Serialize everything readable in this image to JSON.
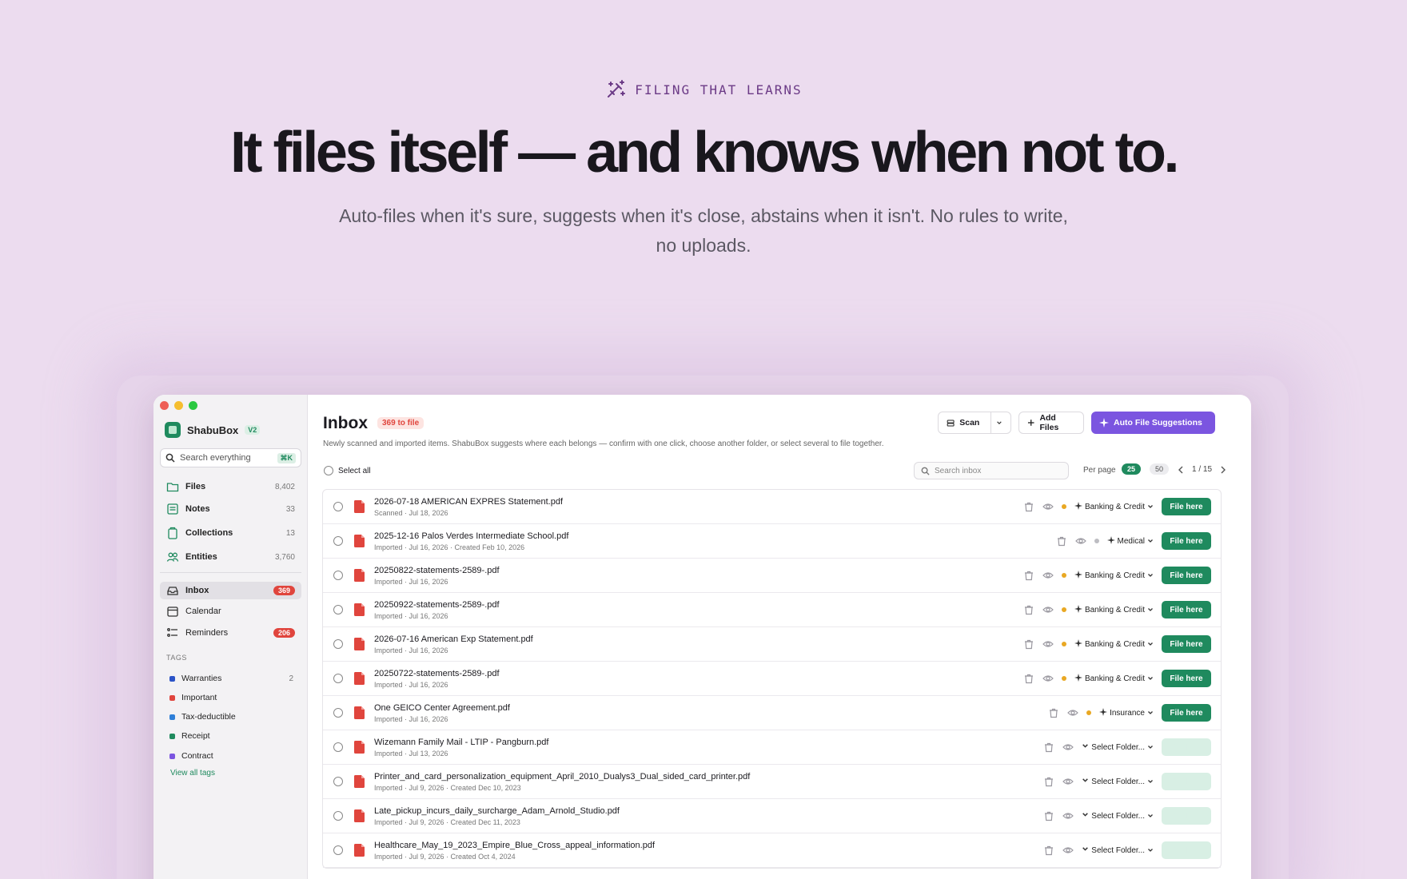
{
  "hero": {
    "eyebrow": "FILING THAT LEARNS",
    "headline": "It files itself — and knows when not to.",
    "subline": "Auto-files when it's sure, suggests when it's close, abstains when it isn't. No rules to write, no uploads."
  },
  "sidebar": {
    "app_name": "ShabuBox",
    "version": "V2",
    "search_placeholder": "Search everything",
    "search_shortcut": "⌘K",
    "library": [
      {
        "label": "Files",
        "count": "8,402",
        "icon": "folder-icon"
      },
      {
        "label": "Notes",
        "count": "33",
        "icon": "note-icon"
      },
      {
        "label": "Collections",
        "count": "13",
        "icon": "collection-icon"
      },
      {
        "label": "Entities",
        "count": "3,760",
        "icon": "people-icon"
      }
    ],
    "workspace": [
      {
        "label": "Inbox",
        "badge": "369",
        "icon": "inbox-icon",
        "active": true
      },
      {
        "label": "Calendar",
        "badge": "",
        "icon": "calendar-icon",
        "active": false
      },
      {
        "label": "Reminders",
        "badge": "206",
        "icon": "reminders-icon",
        "active": false
      }
    ],
    "tags_header": "TAGS",
    "tags": [
      {
        "label": "Warranties",
        "count": "2",
        "color": "#2b53c7"
      },
      {
        "label": "Important",
        "count": "",
        "color": "#e0453d"
      },
      {
        "label": "Tax-deductible",
        "count": "",
        "color": "#2f7fd8"
      },
      {
        "label": "Receipt",
        "count": "",
        "color": "#1f8a5e"
      },
      {
        "label": "Contract",
        "count": "",
        "color": "#7b55e0"
      }
    ],
    "view_all_tags": "View all tags"
  },
  "inbox": {
    "title": "Inbox",
    "badge": "369 to file",
    "description": "Newly scanned and imported items. ShabuBox suggests where each belongs — confirm with one click, choose another folder, or select several to file together.",
    "scan_label": "Scan",
    "add_files_label": "Add Files",
    "auto_suggest_label": "Auto File Suggestions",
    "select_all_label": "Select all",
    "search_placeholder": "Search inbox",
    "per_page_label": "Per page",
    "per_page_options": [
      "25",
      "50"
    ],
    "page_indicator": "1 / 15",
    "file_here_label": "File here",
    "rows": [
      {
        "name": "2026-07-18 AMERICAN EXPRES Statement.pdf",
        "meta": "Scanned · Jul 18, 2026",
        "folder": "Banking & Credit",
        "confidence": "#e9a823",
        "suggested": true
      },
      {
        "name": "2025-12-16 Palos Verdes Intermediate School.pdf",
        "meta": "Imported · Jul 16, 2026 · Created Feb 10, 2026",
        "folder": "Medical",
        "confidence": "#bdbdc2",
        "suggested": true
      },
      {
        "name": "20250822-statements-2589-.pdf",
        "meta": "Imported · Jul 16, 2026",
        "folder": "Banking & Credit",
        "confidence": "#e9a823",
        "suggested": true
      },
      {
        "name": "20250922-statements-2589-.pdf",
        "meta": "Imported · Jul 16, 2026",
        "folder": "Banking & Credit",
        "confidence": "#e9a823",
        "suggested": true
      },
      {
        "name": "2026-07-16 American Exp Statement.pdf",
        "meta": "Imported · Jul 16, 2026",
        "folder": "Banking & Credit",
        "confidence": "#e9a823",
        "suggested": true
      },
      {
        "name": "20250722-statements-2589-.pdf",
        "meta": "Imported · Jul 16, 2026",
        "folder": "Banking & Credit",
        "confidence": "#e9a823",
        "suggested": true
      },
      {
        "name": "One GEICO Center Agreement.pdf",
        "meta": "Imported · Jul 16, 2026",
        "folder": "Insurance",
        "confidence": "#e9a823",
        "suggested": true
      },
      {
        "name": "Wizemann Family Mail - LTIP - Pangburn.pdf",
        "meta": "Imported · Jul 13, 2026",
        "folder": "Select Folder...",
        "confidence": "",
        "suggested": false
      },
      {
        "name": "Printer_and_card_personalization_equipment_April_2010_Dualys3_Dual_sided_card_printer.pdf",
        "meta": "Imported · Jul 9, 2026 · Created Dec 10, 2023",
        "folder": "Select Folder...",
        "confidence": "",
        "suggested": false
      },
      {
        "name": "Late_pickup_incurs_daily_surcharge_Adam_Arnold_Studio.pdf",
        "meta": "Imported · Jul 9, 2026 · Created Dec 11, 2023",
        "folder": "Select Folder...",
        "confidence": "",
        "suggested": false
      },
      {
        "name": "Healthcare_May_19_2023_Empire_Blue_Cross_appeal_information.pdf",
        "meta": "Imported · Jul 9, 2026 · Created Oct 4, 2024",
        "folder": "Select Folder...",
        "confidence": "",
        "suggested": false
      }
    ]
  },
  "colors": {
    "accent_green": "#1f8a5e",
    "accent_purple": "#7b55e0",
    "badge_red": "#e0453d",
    "background": "#ecdcef"
  }
}
